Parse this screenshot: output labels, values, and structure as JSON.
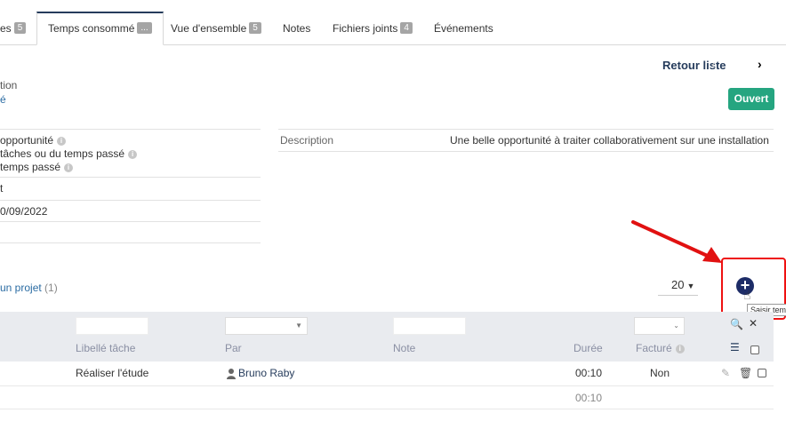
{
  "tabs": [
    {
      "label": "es",
      "badge": "5"
    },
    {
      "label": "Temps consommé",
      "badge": "..."
    },
    {
      "label": "Vue d'ensemble",
      "badge": "5"
    },
    {
      "label": "Notes",
      "badge": ""
    },
    {
      "label": "Fichiers joints",
      "badge": "4"
    },
    {
      "label": "Événements",
      "badge": ""
    }
  ],
  "header": {
    "back_label": "Retour liste",
    "prev_icon": "‹",
    "next_icon": "›",
    "left_line1": "tion",
    "left_line2": "é",
    "status": "Ouvert"
  },
  "info": {
    "line1": "opportunité",
    "line2": "tâches ou du temps passé",
    "line3": "temps passé",
    "row2": "t",
    "row3": "0/09/2022"
  },
  "description": {
    "label": "Description",
    "value": "Une belle opportunité à traiter collaborativement sur une installation"
  },
  "section": {
    "title": "un projet",
    "count": "(1)",
    "page_size": "20",
    "add_tooltip": "Saisir tem"
  },
  "table": {
    "columns": {
      "task": "Libellé tâche",
      "by": "Par",
      "note": "Note",
      "duration": "Durée",
      "billed": "Facturé"
    },
    "rows": [
      {
        "task": "Réaliser l'étude",
        "user": "Bruno Raby",
        "duration": "00:10",
        "billed": "Non"
      }
    ],
    "total_duration": "00:10"
  },
  "colors": {
    "accent": "#263c5c",
    "status_green": "#25a580",
    "add_button": "#1d2c67",
    "highlight_red": "#e11111"
  }
}
